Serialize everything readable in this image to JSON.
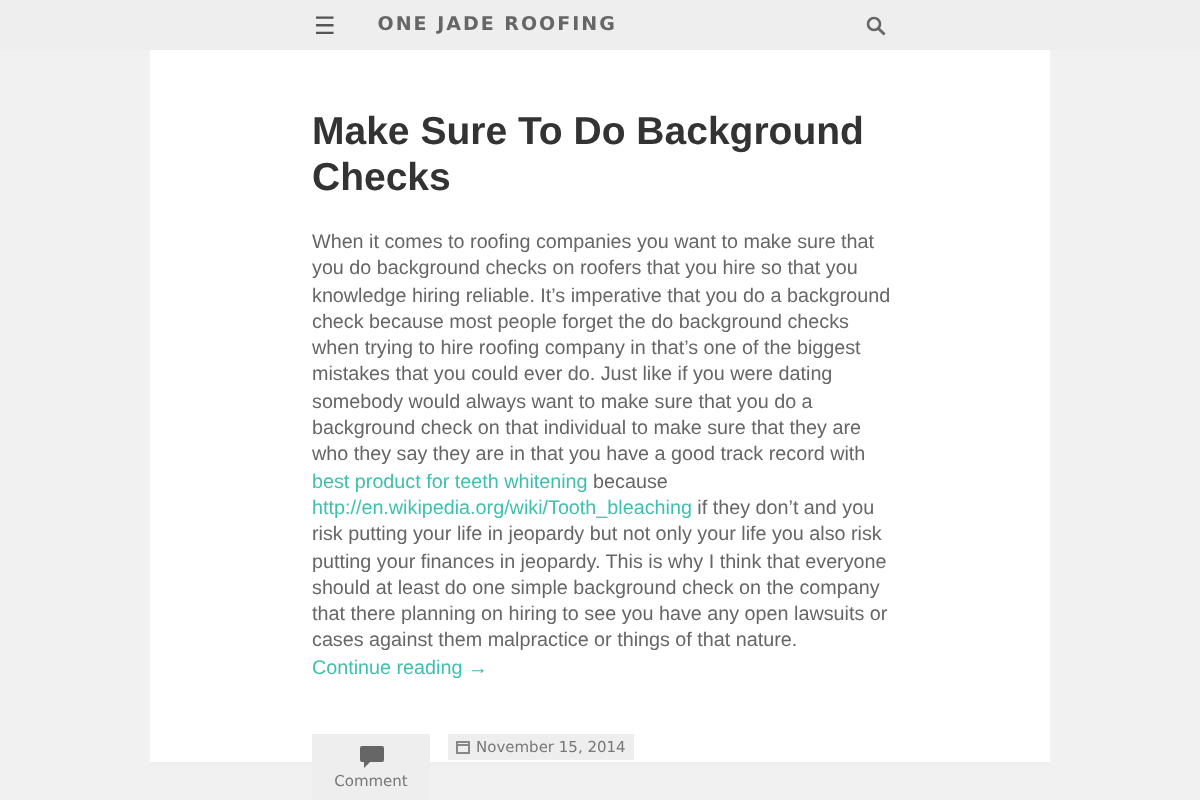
{
  "header": {
    "menu_glyph": "☰",
    "site_title": "ONE JADE ROOFING"
  },
  "post": {
    "title": "Make Sure To Do Background Checks",
    "body": [
      {
        "kind": "text",
        "text": "When it comes to roofing companies you want to make sure that you do background checks on roofers that you hire so that you knowledge hiring reliable. It’s imperative that you do a background check because most people forget the do background checks when trying to hire roofing company in that’s one of the biggest mistakes that you could ever do. Just like if you were dating somebody would always want to make sure that you do a background check on that individual to make sure that they are who they say they are in that you have a good track record with "
      },
      {
        "kind": "link",
        "text": "best product for teeth whitening"
      },
      {
        "kind": "text",
        "text": " because "
      },
      {
        "kind": "link",
        "text": "http://en.wikipedia.org/wiki/Tooth_bleaching"
      },
      {
        "kind": "text",
        "text": " if they don’t and you risk putting your life in jeopardy but not only your life you also risk putting your finances in jeopardy. This is why I think that everyone should at least do one simple background check on the company that there planning on hiring to see you have any open lawsuits or cases against them malpractice or things of that nature. "
      },
      {
        "kind": "link",
        "text": "Continue reading →"
      }
    ],
    "comment_label": "Comment",
    "date": "November 15, 2014"
  }
}
